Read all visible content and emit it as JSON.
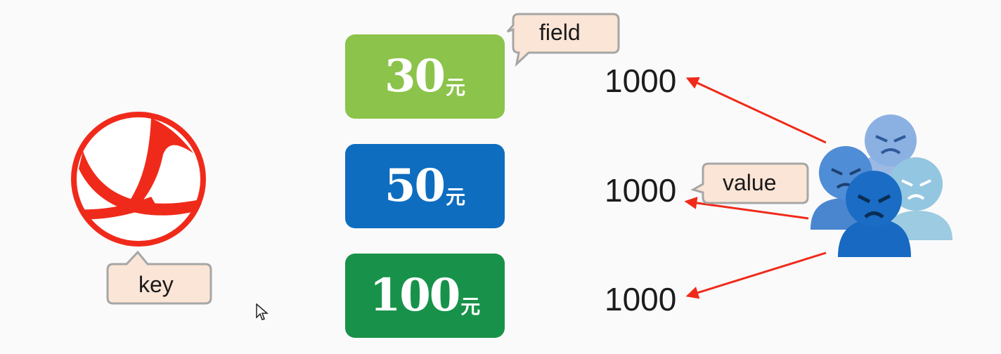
{
  "key_label": "key",
  "field_label": "field",
  "value_label": "value",
  "coupons": [
    {
      "amount": "30",
      "unit": "元",
      "color": "#8cc34a"
    },
    {
      "amount": "50",
      "unit": "元",
      "color": "#0e6dbf"
    },
    {
      "amount": "100",
      "unit": "元",
      "color": "#18924a"
    }
  ],
  "values": [
    "1000",
    "1000",
    "1000"
  ],
  "colors": {
    "arrow": "#f02a1a",
    "logo": "#f02a1a",
    "callout_fill": "#fbe5d6",
    "callout_border": "#a6a6a6"
  }
}
